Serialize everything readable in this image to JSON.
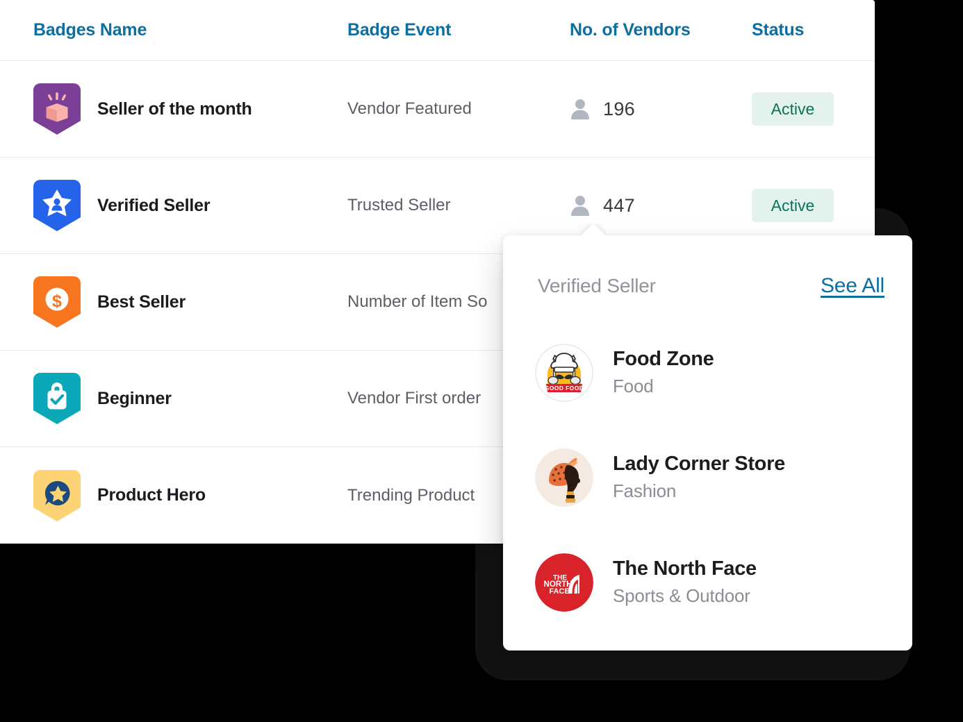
{
  "table": {
    "columns": [
      {
        "key": "badge_name",
        "label": "Badges Name"
      },
      {
        "key": "badge_event",
        "label": "Badge Event"
      },
      {
        "key": "no_of_vendors",
        "label": "No. of Vendors"
      },
      {
        "key": "status",
        "label": "Status"
      }
    ],
    "rows": [
      {
        "badge_name": "Seller of the month",
        "badge_event": "Vendor Featured",
        "vendors": "196",
        "status": "Active",
        "badge_icon": "gift-box-shield-badge-icon",
        "badge_color": "#7b3f98",
        "badge_accent": "#fcb3ac"
      },
      {
        "badge_name": "Verified Seller",
        "badge_event": "Trusted Seller",
        "vendors": "447",
        "status": "Active",
        "badge_icon": "star-person-shield-badge-icon",
        "badge_color": "#2563eb",
        "badge_accent": "#ffffff"
      },
      {
        "badge_name": "Best Seller",
        "badge_event": "Number of Item So",
        "vendors": "",
        "status": "",
        "badge_icon": "dollar-coin-shield-badge-icon",
        "badge_color": "#f8761f",
        "badge_accent": "#ffffff"
      },
      {
        "badge_name": "Beginner",
        "badge_event": "Vendor First order",
        "vendors": "",
        "status": "",
        "badge_icon": "shopping-bag-check-shield-badge-icon",
        "badge_color": "#0aa8b8",
        "badge_accent": "#ffffff"
      },
      {
        "badge_name": "Product Hero",
        "badge_event": "Trending Product",
        "vendors": "",
        "status": "",
        "badge_icon": "speech-bubble-star-shield-badge-icon",
        "badge_color": "#fcd375",
        "badge_accent": "#1b4a7e"
      }
    ]
  },
  "popup": {
    "title": "Verified Seller",
    "see_all_label": "See All",
    "vendors": [
      {
        "name": "Food Zone",
        "category": "Food",
        "logo": "good-food-chef-logo-icon",
        "logo_text": "GOOD FOOD"
      },
      {
        "name": "Lady Corner Store",
        "category": "Fashion",
        "logo": "lady-headwrap-logo-icon",
        "logo_text": ""
      },
      {
        "name": "The North Face",
        "category": "Sports & Outdoor",
        "logo": "the-north-face-logo-icon",
        "logo_text": "THE NORTH FACE"
      }
    ]
  },
  "colors": {
    "header_text": "#0d6ea0",
    "link": "#0d6ea0",
    "status_active_bg": "#e3f2ec",
    "status_active_text": "#0f7158",
    "page_background": "#000000",
    "card_background": "#ffffff",
    "muted_text": "#5c5f66"
  }
}
